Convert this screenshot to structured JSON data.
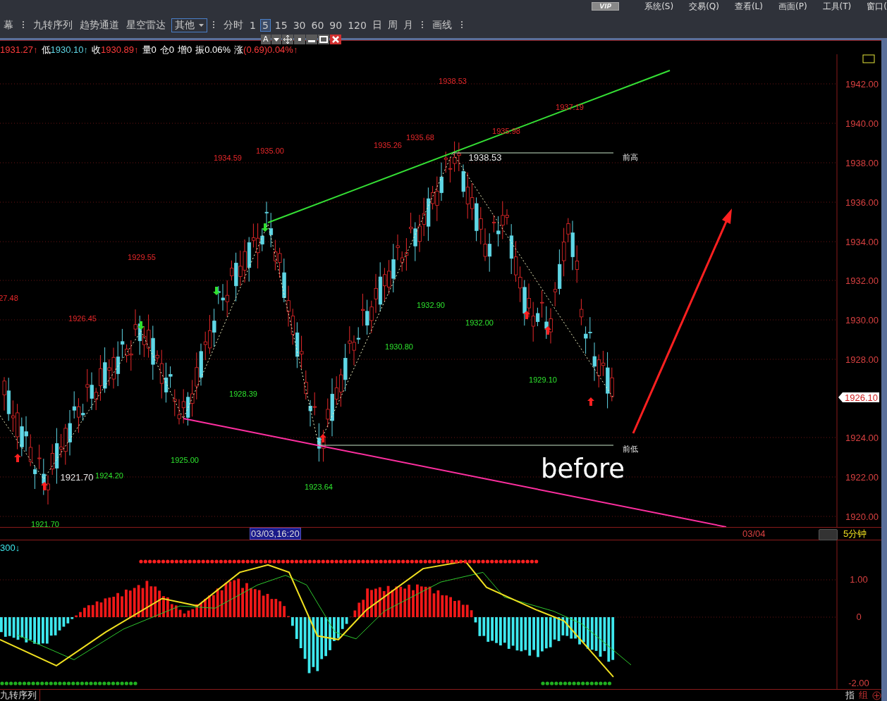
{
  "menu_bar": {
    "badge": "VIP",
    "items": [
      "系统(S)",
      "交易(Q)",
      "查看(L)",
      "画面(P)",
      "工具(T)",
      "窗口("
    ]
  },
  "toolbar": {
    "leading": "幕",
    "indicators": [
      "九转序列",
      "趋势通道",
      "星空雷达"
    ],
    "dropdown": "其他",
    "intraday": "分时",
    "periods": [
      {
        "label": "1",
        "selected": false
      },
      {
        "label": "5",
        "selected": true
      },
      {
        "label": "15",
        "selected": false
      },
      {
        "label": "30",
        "selected": false
      },
      {
        "label": "60",
        "selected": false
      },
      {
        "label": "90",
        "selected": false
      },
      {
        "label": "120",
        "selected": false
      },
      {
        "label": "日",
        "selected": false
      },
      {
        "label": "周",
        "selected": false
      },
      {
        "label": "月",
        "selected": false
      }
    ],
    "draw_lines": "画线",
    "mini_controls": {
      "font": "A"
    }
  },
  "quote_line": [
    {
      "value": "1931.27↑",
      "color": "#ff3b3b"
    },
    {
      "label": "低",
      "value": "1930.10↑",
      "color": "#5fd7e6"
    },
    {
      "label": "收",
      "value": "1930.89↑",
      "color": "#ff3b3b"
    },
    {
      "label": "量",
      "value": "0"
    },
    {
      "label": "仓",
      "value": "0"
    },
    {
      "label": "增",
      "value": "0"
    },
    {
      "label": "振",
      "value": "0.06%"
    },
    {
      "label": "涨",
      "value": "(0.69)0.04%↑",
      "color": "#ff3b3b"
    }
  ],
  "main_chart": {
    "y_axis": [
      "1942.00",
      "1940.00",
      "1938.00",
      "1936.00",
      "1934.00",
      "1932.00",
      "1930.00",
      "1928.00",
      "1924.00",
      "1922.00",
      "1920.00"
    ],
    "current_price": "1926.10",
    "labels": [
      {
        "text": "1938.53",
        "kind": "up"
      },
      {
        "text": "1937.19",
        "kind": "up"
      },
      {
        "text": "1935.98",
        "kind": "up"
      },
      {
        "text": "1935.68",
        "kind": "up"
      },
      {
        "text": "1935.26",
        "kind": "up"
      },
      {
        "text": "1935.00",
        "kind": "up"
      },
      {
        "text": "1934.59",
        "kind": "up"
      },
      {
        "text": "1929.55",
        "kind": "up"
      },
      {
        "text": "1926.45",
        "kind": "up"
      },
      {
        "text": "27.48",
        "kind": "up"
      },
      {
        "text": "1932.90",
        "kind": "down"
      },
      {
        "text": "1932.00",
        "kind": "down"
      },
      {
        "text": "1930.80",
        "kind": "down"
      },
      {
        "text": "1929.10",
        "kind": "down"
      },
      {
        "text": "1928.39",
        "kind": "down"
      },
      {
        "text": "1925.00",
        "kind": "down"
      },
      {
        "text": "1924.20",
        "kind": "down"
      },
      {
        "text": "1923.64",
        "kind": "down"
      },
      {
        "text": "1921.70",
        "kind": "down"
      },
      {
        "text": "1938.53",
        "kind": "pivot"
      },
      {
        "text": "1921.70",
        "kind": "pivot"
      }
    ],
    "previous_high": "前高",
    "previous_low": "前低",
    "annotation": "before"
  },
  "time_bar": {
    "cursor_time": "03/03,16:20",
    "next_date": "03/04",
    "period": "5分钟"
  },
  "indicator": {
    "title": "300↓",
    "y_axis": [
      "1.00",
      "0",
      "-2.00"
    ]
  },
  "footer": {
    "tab": "九转序列",
    "buttons": [
      "指",
      "组"
    ]
  }
}
